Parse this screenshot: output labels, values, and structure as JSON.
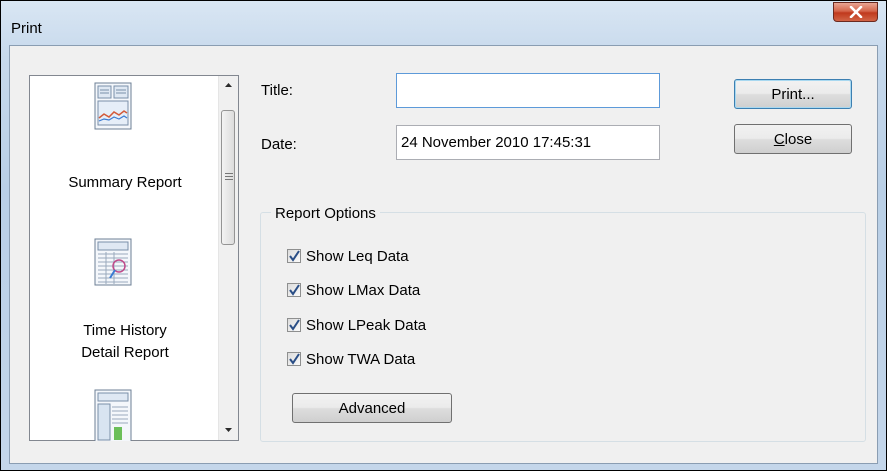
{
  "window": {
    "title": "Print",
    "close_icon": "close-x-icon"
  },
  "report_list": {
    "items": [
      {
        "label_lines": [
          "Summary Report"
        ],
        "icon": "summary-report-icon"
      },
      {
        "label_lines": [
          "Time History",
          "Detail Report"
        ],
        "icon": "time-history-report-icon"
      },
      {
        "label_lines": [],
        "icon": "table-report-icon"
      }
    ]
  },
  "fields": {
    "title_label": "Title:",
    "title_value": "",
    "date_label": "Date:",
    "date_value": "24 November 2010 17:45:31"
  },
  "buttons": {
    "print": "Print...",
    "close": "Close",
    "advanced": "Advanced"
  },
  "report_options": {
    "group_title": "Report Options",
    "options": [
      {
        "label": "Show Leq Data",
        "checked": true
      },
      {
        "label": "Show LMax Data",
        "checked": true
      },
      {
        "label": "Show LPeak Data",
        "checked": true
      },
      {
        "label": "Show TWA Data",
        "checked": true
      }
    ]
  }
}
